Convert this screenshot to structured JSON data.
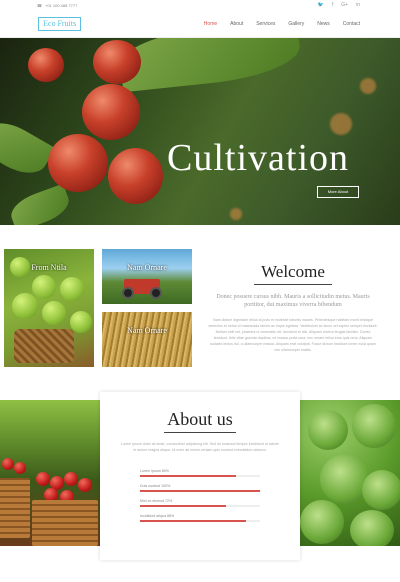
{
  "topbar": {
    "phone": "+01 100 488 7777",
    "social_icons": [
      "twitter-icon",
      "facebook-icon",
      "google-plus-icon",
      "linkedin-icon"
    ]
  },
  "header": {
    "logo": "Eco Fruits",
    "nav": [
      "Home",
      "About",
      "Services",
      "Gallery",
      "News",
      "Contact"
    ],
    "active_index": 0
  },
  "hero": {
    "title": "Cultivation",
    "button": "More About"
  },
  "gallery": [
    {
      "caption": "From Ntila"
    },
    {
      "caption": "Nam Ornare"
    },
    {
      "caption": "Nam Ornare"
    }
  ],
  "welcome": {
    "title": "Welcome",
    "subtitle": "Donec posuere cursus nibh. Mauris a sollicitudin metus. Mauris porttitor, dui maximus viverra bibendum",
    "body": "Nam dictum dignissim tellus id justo et molestie lobortis mauris. Pellentesque habitant morbi tristique senectus et netus et malesuada fames ac turpis egestas. Vestibulum ac lacus vel sapien semper tincidunt. Nullam velit est, pharetra ut venenatis vel, tincidunt et nisi. Aliquam viverra feugiat facilisis. Donec tincidunt, felis vitae gravida dapibus, mi massa porta urna, nec ornare tellus eros quis urna. Aliquam sodales lectus dui, a ullamcorper massa. Aliquam erat volutpat. Fusce dictum tincidunt lorem nulla quam nec ullamcorper mattis."
  },
  "about": {
    "title": "About us",
    "body": "Lorem ipsum dolor sit amet, consectetur adipiscing elit. Sed do eiusmod tempor incididunt ut labore et dolore magna aliqua. Ut enim ad minim veniam quis nostrud exercitation ullamco.",
    "skills": [
      {
        "label": "Lorem ipsum",
        "value": 80,
        "text": "Lorem ipsum  80%"
      },
      {
        "label": "Duis nostrud",
        "value": 100,
        "text": "Duis nostrud  100%"
      },
      {
        "label": "Mini ex eismod",
        "value": 72,
        "text": "Mini ex eismod  72%"
      },
      {
        "label": "Incididunt aliqua",
        "value": 88,
        "text": "Incididunt aliqua  88%"
      }
    ]
  },
  "colors": {
    "accent": "#d9534f",
    "logo": "#5bc0de"
  }
}
